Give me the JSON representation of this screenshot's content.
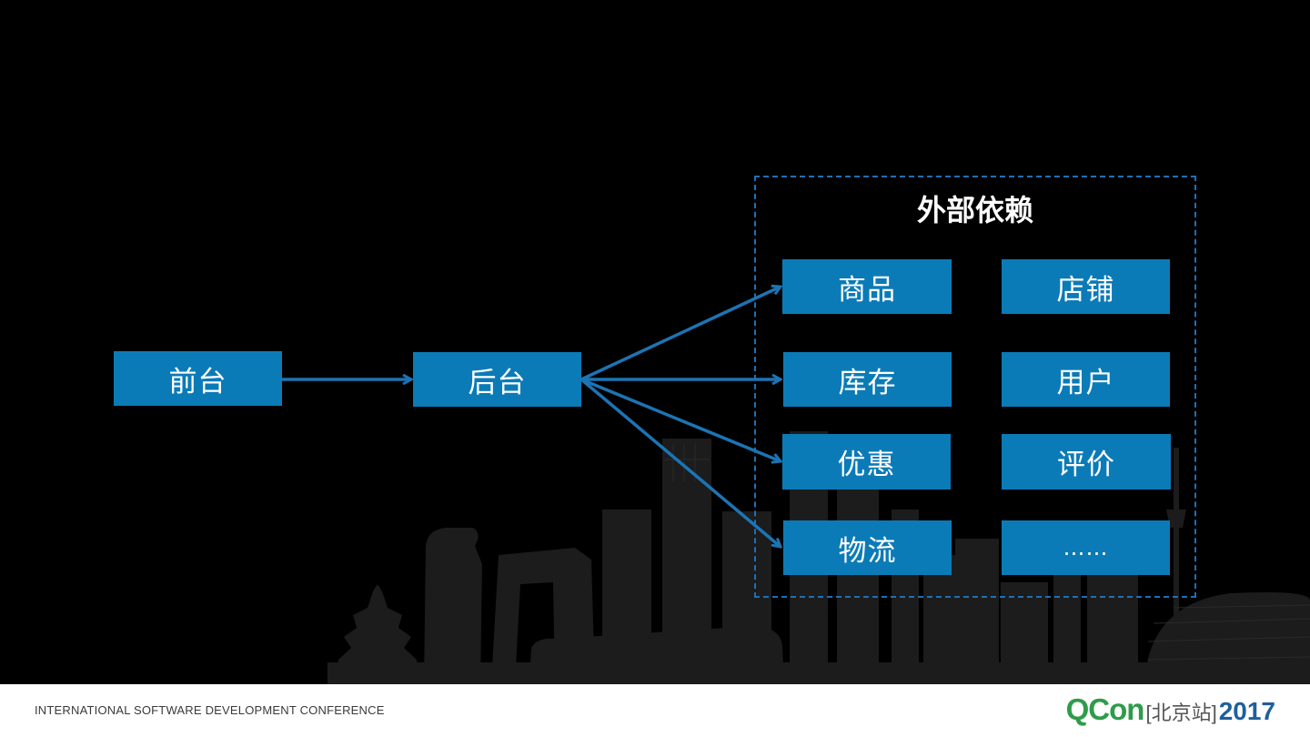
{
  "diagram": {
    "nodes": {
      "frontend": "前台",
      "backend": "后台"
    },
    "dependency_group": {
      "title": "外部依赖",
      "items": [
        "商品",
        "店铺",
        "库存",
        "用户",
        "优惠",
        "评价",
        "物流",
        "……"
      ]
    },
    "edges": [
      {
        "from": "前台",
        "to": "后台"
      },
      {
        "from": "后台",
        "to": "商品"
      },
      {
        "from": "后台",
        "to": "库存"
      },
      {
        "from": "后台",
        "to": "优惠"
      },
      {
        "from": "后台",
        "to": "物流"
      }
    ],
    "colors": {
      "box": "#0b7bb7",
      "arrow": "#1c74b4",
      "frame": "#1f6fb5"
    }
  },
  "footer": {
    "conference": "INTERNATIONAL SOFTWARE DEVELOPMENT CONFERENCE",
    "brand_name": "QCon",
    "brand_city": "[北京站]",
    "brand_year": "2017"
  }
}
